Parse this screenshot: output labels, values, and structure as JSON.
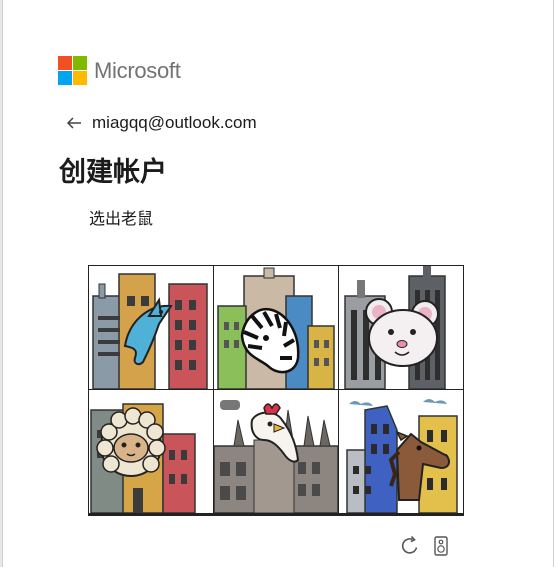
{
  "brand": {
    "name": "Microsoft",
    "colors": [
      "#f25022",
      "#7fba00",
      "#00a4ef",
      "#ffb900"
    ]
  },
  "identity": {
    "email": "miagqq@outlook.com",
    "back_icon": "arrow-left-icon"
  },
  "heading": "创建帐户",
  "challenge": {
    "prompt": "选出老鼠",
    "tiles": [
      {
        "animal": "dolphin-icon"
      },
      {
        "animal": "zebra-icon"
      },
      {
        "animal": "mouse-icon"
      },
      {
        "animal": "sheep-icon"
      },
      {
        "animal": "chicken-icon"
      },
      {
        "animal": "horse-icon"
      }
    ]
  },
  "controls": {
    "refresh_icon": "refresh-icon",
    "audio_icon": "speaker-icon"
  }
}
